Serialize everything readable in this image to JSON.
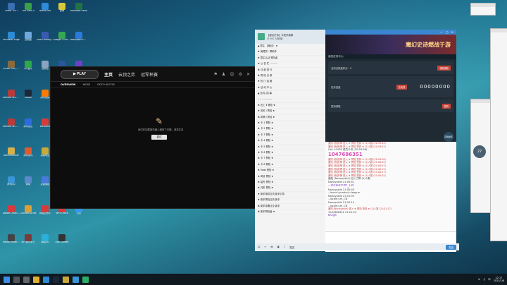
{
  "desktop_icons": [
    {
      "label": "Cheat TEST",
      "color": "#3a6fb0"
    },
    {
      "label": "Microsoft Edge",
      "color": "#2c8bd6"
    },
    {
      "label": "Clicker Full (X64)",
      "color": "#8a6a3a"
    },
    {
      "label": "Remote WSM Client",
      "color": "#b83a3a"
    },
    {
      "label": "Remote WCA Client",
      "color": "#b83a3a"
    },
    {
      "label": "Administrator",
      "color": "#d8b04a"
    },
    {
      "label": "腾讯QQ",
      "color": "#3a95d9"
    },
    {
      "label": "Adobe Creative Cloud",
      "color": "#d93a3a"
    },
    {
      "label": "Media Player Classic",
      "color": "#444"
    },
    {
      "label": "The Sims 4",
      "color": "#3aa04a"
    },
    {
      "label": "此电脑",
      "color": "#6fa8dc"
    },
    {
      "label": "QQ音乐",
      "color": "#2fa84a"
    },
    {
      "label": "Steam",
      "color": "#1b2838"
    },
    {
      "label": "腾讯会议",
      "color": "#2d6be0"
    },
    {
      "label": "腾讯游戏",
      "color": "#e05a2d"
    },
    {
      "label": "网络",
      "color": "#5a8ac9"
    },
    {
      "label": "Counter-Strike",
      "color": "#d9a03a"
    },
    {
      "label": "地下城与勇士",
      "color": "#7a3a3a"
    },
    {
      "label": "Battle.net",
      "color": "#2f8ad9"
    },
    {
      "label": "Final Fantasy XIV",
      "color": "#3a5ab0"
    },
    {
      "label": "回收站",
      "color": "#8aa4c0"
    },
    {
      "label": "腾讯视频",
      "color": "#ff7a00"
    },
    {
      "label": "WeGame",
      "color": "#d93a3a"
    },
    {
      "label": "英雄联盟",
      "color": "#c9a93a"
    },
    {
      "label": "控制面板",
      "color": "#4a7ad9"
    },
    {
      "label": "网易云音乐",
      "color": "#d93a3a"
    },
    {
      "label": "网易UU",
      "color": "#2ab0d9"
    },
    {
      "label": "原神",
      "color": "#d9c93a"
    },
    {
      "label": "Google Chrome",
      "color": "#34a853"
    },
    {
      "label": "Microsoft Word",
      "color": "#2b579a"
    },
    {
      "label": "Discord",
      "color": "#5865f2"
    },
    {
      "label": "Epic Games Launcher",
      "color": "#333"
    },
    {
      "label": "OBS Studio",
      "color": "#222"
    },
    {
      "label": "Media",
      "color": "#555"
    },
    {
      "label": "WPS Office",
      "color": "#d93a3a"
    },
    {
      "label": "Epic Games",
      "color": "#333"
    },
    {
      "label": "Microsoft Excel",
      "color": "#217346"
    },
    {
      "label": "Wallpaper Engine",
      "color": "#2a7ad9"
    },
    {
      "label": "GitHub Desktop",
      "color": "#6e40c9"
    },
    {
      "label": "Origin",
      "color": "#f56c2d"
    },
    {
      "label": "Yuanshen",
      "color": "#d9c93a"
    },
    {
      "label": "Bilibili",
      "color": "#fb7299"
    },
    {
      "label": "微信",
      "color": "#2aae67"
    },
    {
      "label": "钉钉",
      "color": "#3296fa"
    }
  ],
  "launcher": {
    "play_label": "▶ PLAY",
    "tabs": [
      "主页",
      "云顶之弈",
      "冠军杯赛"
    ],
    "subnav": [
      "OVERVIEW",
      "NEWS",
      "PATCH NOTES"
    ],
    "loading_message": "我们在加载服务器上遇到了问题，请求并没有完成。请检查你的网络连接后重试。",
    "retry_label": "重试"
  },
  "qq_left": {
    "header": "【魔幻史诗】今夏来袭群",
    "sub": "(7.9 K 人在线)",
    "members": [
      "▲ 群主 【魔幻】 ★",
      "♦ 管理员 · 群助手",
      "♦ 群主认证 冒险者",
      "♠ 公 告 栏 · ─ ─ ─",
      "♣ 月 度 排 行",
      "♣ 冒 险 记 录",
      "♦ 热 门 话 题",
      "♠ 活 动 中 心",
      "▲ 战 队 招 募",
      "─ ─ ─ ─ ─ ─ ─",
      "♠ 出工 Ⅱ 冒险 ★",
      "♦ 彩虹 Ⅰ 冒险 ★",
      "♣ 雾萌 Ⅰ 冒险 ★",
      "♠ 卡 1 冒险 ★",
      "♠ 卡 2 冒险 ★",
      "♠ 卡 3 冒险 ★",
      "♠ 卡 4 冒险 ★",
      "♠ 卡 5 冒险 ★",
      "♠ 卡 6 冒险 ★",
      "♠ 卡 7 冒险 ★",
      "♠ 卡 8 冒险 ★",
      "♠ Yada 冒险 ★",
      "♠ 风铃 冒险 ★",
      "♠ 晨光 冒险 ★",
      "♠ 月影 冒险 ★",
      "♦ 新手指导交流 新手引导",
      "♦ 新手冒险交流 新手",
      "♣ 新手攻略讨论 新手",
      "♣ 新手冒险者 ★"
    ]
  },
  "qq_main": {
    "banner_title": "魔幻史诗燃战于游",
    "panel_header": "我的任务中心",
    "card1": "当前活跃度积分：0",
    "card1_btn": "领取奖励",
    "card2": "任务进度",
    "card2_btn": "去完成",
    "code": "00000000",
    "card3": "签到领取",
    "card3_btn": "签到",
    "assistant": "召唤助手",
    "chat": [
      {
        "type": "name",
        "text": "通知 (系统)等 进入 ★ 冒险 签到 ★     (1)人数 (20:59:44)"
      },
      {
        "type": "name",
        "text": "通知 (系统)等 进入 ★ 冒险 签到 ★     (1)人数 (20:59:52)"
      },
      {
        "type": "small",
        "text": "Uid: 10478 成员卡号 (20:59:58)"
      },
      {
        "type": "big",
        "text": "1047686351"
      },
      {
        "type": "name",
        "text": "通知 (系统)等 进入 ★ 冒险 签到 ★     (1)人数 (20:59:58)"
      },
      {
        "type": "name",
        "text": "通知 (系统)等 进入 ★ 冒险 签到 ★     (1)人数 (21:00:05)"
      },
      {
        "type": "name",
        "text": "通知 (系统)等 进入 ★ 冒险 签到 ★     (1)人数 (21:00:07)"
      },
      {
        "type": "name",
        "text": "通知 (系统)等 进入 ★ 冒险 签到 ★     (1)人数 (21:00:12)"
      },
      {
        "type": "name",
        "text": "通知 (系统)等 进入 ★ 冒险 签到 ★     (1)人数 (21:00:27)"
      },
      {
        "type": "name",
        "text": "通知 (系统)等 进入 ★ 冒险 签到 ★     (1)人数 (21:00:35)"
      },
      {
        "type": "small",
        "text": "通知 (Nanayasile) 加入了群 (1)人数"
      },
      {
        "type": "small",
        "text": "Nanayasile 21:00:41"
      },
      {
        "type": "mid",
        "text": "--locale=zh_CN"
      },
      {
        "type": "small",
        "text": "Nanayasile 21:00:49"
      },
      {
        "type": "small",
        "text": "--launch-product=league"
      },
      {
        "type": "small",
        "text": "Nanayasile 21:01:03"
      },
      {
        "type": "small",
        "text": "--locale=zh_CN"
      },
      {
        "type": "small",
        "text": "Nanayasile 21:01:10"
      },
      {
        "type": "small",
        "text": "--locale=zh_CN"
      },
      {
        "type": "name",
        "text": "通知 (Nanayasile) 进入 ★ 冒险 签到 ★     (1)人数 (21:01:17)"
      },
      {
        "type": "small",
        "text": "1047686351 21:01:24"
      },
      {
        "type": "mid",
        "text": "Bugs"
      }
    ],
    "toolbar_hint": "发送",
    "send_label": "发送"
  },
  "taskbar": {
    "time": "22:17",
    "date": "2021/1/8",
    "lang": "中"
  },
  "clock_widget": "27"
}
